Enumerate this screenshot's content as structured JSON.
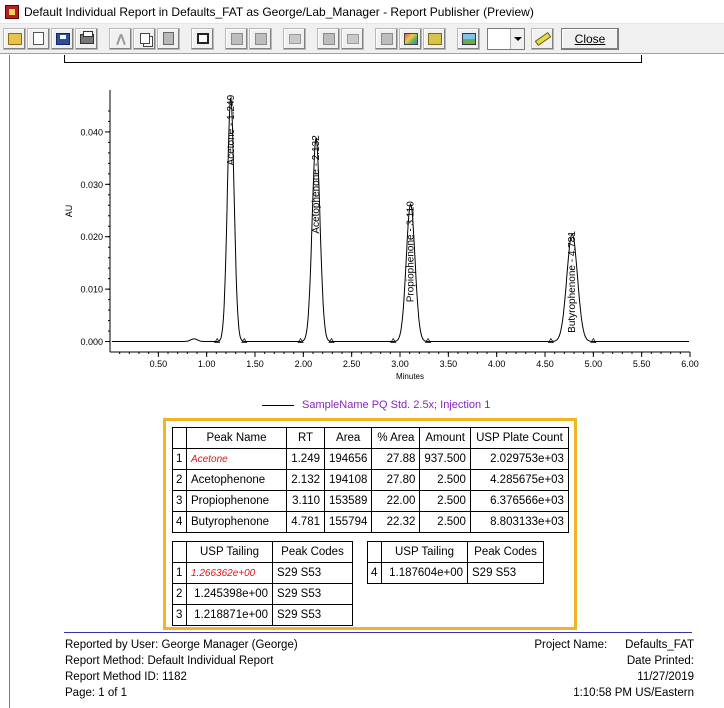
{
  "window": {
    "title": "Default Individual Report in Defaults_FAT as George/Lab_Manager - Report Publisher (Preview)"
  },
  "toolbar": {
    "buttons": [
      "open-icon",
      "new-page-icon",
      "save-icon",
      "print-icon",
      "cut-icon",
      "copy-icon",
      "paste-icon",
      "frame-icon",
      "align-left-icon",
      "align-right-icon",
      "grid-icon",
      "text-style-icon",
      "font-icon",
      "insert-field-icon",
      "palette-icon",
      "picture-icon",
      "export-icon"
    ],
    "zoom_value": "",
    "close_label": "Close"
  },
  "chart_data": {
    "type": "line",
    "xlabel": "Minutes",
    "ylabel": "AU",
    "xlim": [
      0.0,
      6.0
    ],
    "ylim": [
      -0.002,
      0.048
    ],
    "x_ticks": [
      "0.50",
      "1.00",
      "1.50",
      "2.00",
      "2.50",
      "3.00",
      "3.50",
      "4.00",
      "4.50",
      "5.00",
      "5.50",
      "6.00"
    ],
    "y_ticks": [
      "0.000",
      "0.010",
      "0.020",
      "0.030",
      "0.040"
    ],
    "grid": false,
    "legend_position": "bottom",
    "series": [
      {
        "name": "SampleName PQ Std. 2.5x; Injection 1",
        "peaks": [
          {
            "rt": 1.249,
            "height": 0.0465,
            "width": 0.035,
            "label": "Acetone - 1.249"
          },
          {
            "rt": 2.132,
            "height": 0.0388,
            "width": 0.04,
            "label": "Acetophenone - 2.132"
          },
          {
            "rt": 3.11,
            "height": 0.0262,
            "width": 0.045,
            "label": "Propiophenone - 3.110"
          },
          {
            "rt": 4.781,
            "height": 0.0205,
            "width": 0.055,
            "label": "Butyrophenone - 4.781"
          }
        ]
      }
    ]
  },
  "peak_table": {
    "headers": [
      "Peak Name",
      "RT",
      "Area",
      "% Area",
      "Amount",
      "USP Plate Count"
    ],
    "rows": [
      {
        "idx": "1",
        "name": "Acetone",
        "rt": "1.249",
        "area": "194656",
        "pct": "27.88",
        "amount": "937.500",
        "plates": "2.029753e+03"
      },
      {
        "idx": "2",
        "name": "Acetophenone",
        "rt": "2.132",
        "area": "194108",
        "pct": "27.80",
        "amount": "2.500",
        "plates": "4.285675e+03"
      },
      {
        "idx": "3",
        "name": "Propiophenone",
        "rt": "3.110",
        "area": "153589",
        "pct": "22.00",
        "amount": "2.500",
        "plates": "6.376566e+03"
      },
      {
        "idx": "4",
        "name": "Butyrophenone",
        "rt": "4.781",
        "area": "155794",
        "pct": "22.32",
        "amount": "2.500",
        "plates": "8.803133e+03"
      }
    ]
  },
  "tailing_left": {
    "headers": [
      "USP Tailing",
      "Peak Codes"
    ],
    "rows": [
      {
        "idx": "1",
        "tailing": "1.266362e+00",
        "codes": "S29 S53"
      },
      {
        "idx": "2",
        "tailing": "1.245398e+00",
        "codes": "S29 S53"
      },
      {
        "idx": "3",
        "tailing": "1.218871e+00",
        "codes": "S29 S53"
      }
    ]
  },
  "tailing_right": {
    "headers": [
      "USP Tailing",
      "Peak Codes"
    ],
    "rows": [
      {
        "idx": "4",
        "tailing": "1.187604e+00",
        "codes": "S29 S53"
      }
    ]
  },
  "footer": {
    "reported_by": "Reported by User:  George Manager (George)",
    "report_method": "Report Method:  Default Individual Report",
    "report_method_id": "Report Method ID: 1182",
    "page": "Page: 1 of 1",
    "project_label": "Project Name:",
    "project_value": "Defaults_FAT",
    "date_printed_label": "Date Printed:",
    "date_value": "11/27/2019",
    "time_value": "1:10:58 PM US/Eastern"
  },
  "colors": {
    "highlight_border": "#f2b422",
    "legend_text": "#8b1fc4",
    "emphasis_red": "#e01515",
    "footer_rule": "#3333aa"
  }
}
